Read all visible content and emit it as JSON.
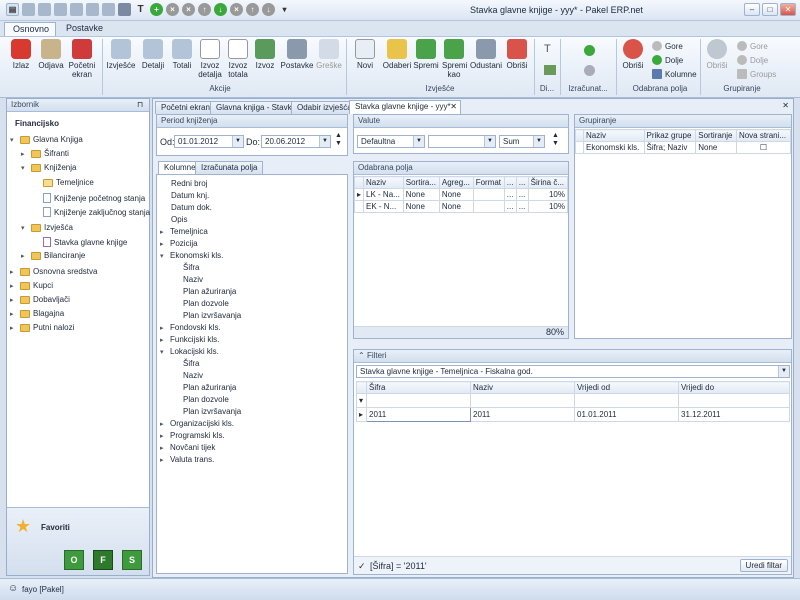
{
  "window": {
    "title": "Stavka glavne knjige - yyy* - Pakel ERP.net"
  },
  "ribbon_tabs": [
    "Osnovno",
    "Postavke"
  ],
  "ribbon": {
    "buttons": [
      "Izlaz",
      "Odjava",
      "Početni ekran",
      "Izvješće",
      "Detalji",
      "Totali",
      "Izvoz detalja",
      "Izvoz totala",
      "Izvoz",
      "Postavke",
      "Greške",
      "Novi",
      "Odaberi",
      "Spremi",
      "Spremi kao",
      "Odustani",
      "Obriši",
      "Obriši",
      "Obriši"
    ],
    "groups": [
      "Akcije",
      "Izvješće",
      "Di...",
      "Izračunat...",
      "Odabrana polja",
      "Grupiranje"
    ],
    "small": [
      "Gore",
      "Dolje",
      "Kolumne",
      "Gore",
      "Dolje",
      "Groups"
    ]
  },
  "sidebar": {
    "header": "Izbornik",
    "section": "Financijsko",
    "items": [
      "Glavna Knjiga",
      "Šifranti",
      "Knjiženja",
      "Temeljnice",
      "Knjiženje početnog stanja",
      "Knjiženje zaključnog stanja",
      "Izvješća",
      "Stavka glavne knjige",
      "Bilanciranje",
      "Osnovna sredstva",
      "Kupci",
      "Dobavljači",
      "Blagajna",
      "Putni nalozi"
    ],
    "favorites": "Favoriti",
    "fav_buttons": [
      "O",
      "F",
      "S"
    ]
  },
  "doc_tabs": [
    "Početni ekran",
    "Glavna knjiga - Stavke",
    "Odabir izvješća",
    "Stavka glavne knjige - yyy*"
  ],
  "period": {
    "title": "Period knjiženja",
    "od_label": "Od:",
    "od": "01.01.2012",
    "do_label": "Do:",
    "do": "20.06.2012"
  },
  "left_tabs": [
    "Kolumne",
    "Izračunata polja"
  ],
  "columns_tree": [
    "Redni broj",
    "Datum knj.",
    "Datum dok.",
    "Opis",
    "Temeljnica",
    "Pozicija",
    "Ekonomski kls.",
    "Šifra",
    "Naziv",
    "Plan ažuriranja",
    "Plan dozvole",
    "Plan izvršavanja",
    "Fondovski kls.",
    "Funkcijski kls.",
    "Lokacijski kls.",
    "Šifra",
    "Naziv",
    "Plan ažuriranja",
    "Plan dozvole",
    "Plan izvršavanja",
    "Organizacijski kls.",
    "Programski kls.",
    "Novčani tijek",
    "Valuta trans."
  ],
  "valute": {
    "title": "Valute",
    "value": "Defaultna",
    "agg": "Sum"
  },
  "odabrana": {
    "title": "Odabrana polja",
    "headers": [
      "Naziv",
      "Sortira...",
      "Agreg...",
      "Format",
      "...",
      "...",
      "Širina č..."
    ],
    "rows": [
      [
        "LK - Na...",
        "None",
        "None",
        "",
        "...",
        "...",
        "10%"
      ],
      [
        "EK - N...",
        "None",
        "None",
        "",
        "...",
        "...",
        "10%"
      ]
    ],
    "total": "80%"
  },
  "grupiranje": {
    "title": "Grupiranje",
    "headers": [
      "Naziv",
      "Prikaz grupe",
      "Sortiranje",
      "Nova strani..."
    ],
    "rows": [
      [
        "Ekonomski kls.",
        "Šifra; Naziv",
        "None",
        ""
      ]
    ]
  },
  "filteri": {
    "title": "Filteri",
    "source": "Stavka glavne knjige - Temeljnica - Fiskalna god.",
    "headers": [
      "Šifra",
      "Naziv",
      "Vrijedi od",
      "Vrijedi do"
    ],
    "row": [
      "2011",
      "2011",
      "01.01.2011",
      "31.12.2011"
    ],
    "expression": "[Šifra] = '2011'",
    "edit_button": "Uredi filtar"
  },
  "status": {
    "user": "fayo [Pakel]"
  }
}
